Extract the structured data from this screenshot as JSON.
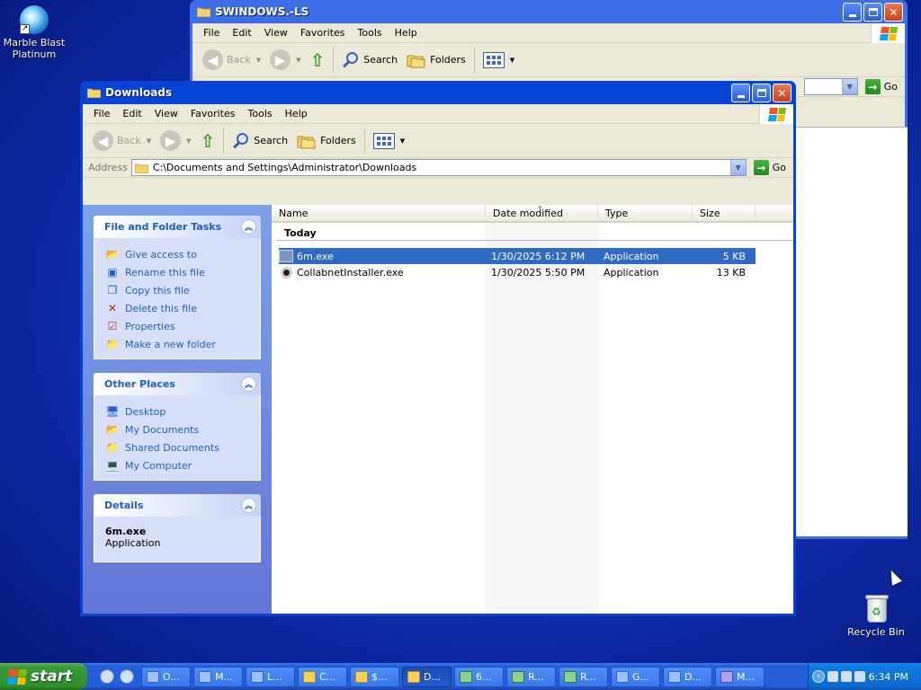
{
  "desktop": {
    "icons": [
      {
        "label": "Marble Blast Platinum",
        "icon": "marble-blast-icon"
      },
      {
        "label": "Recycle Bin",
        "icon": "recycle-bin-icon"
      }
    ]
  },
  "back_window": {
    "title": "SWINDOWS.-LS",
    "menu": [
      "File",
      "Edit",
      "View",
      "Favorites",
      "Tools",
      "Help"
    ],
    "toolbar": {
      "back": "Back",
      "search": "Search",
      "folders": "Folders"
    },
    "go": "Go"
  },
  "front_window": {
    "title": "Downloads",
    "menu": [
      "File",
      "Edit",
      "View",
      "Favorites",
      "Tools",
      "Help"
    ],
    "toolbar": {
      "back": "Back",
      "search": "Search",
      "folders": "Folders"
    },
    "address": {
      "label": "Address",
      "value": "C:\\Documents and Settings\\Administrator\\Downloads",
      "go": "Go"
    },
    "file_tasks": {
      "title": "File and Folder Tasks",
      "items": [
        "Give access to",
        "Rename this file",
        "Copy this file",
        "Delete this file",
        "Properties",
        "Make a new folder"
      ]
    },
    "other_places": {
      "title": "Other Places",
      "items": [
        "Desktop",
        "My Documents",
        "Shared Documents",
        "My Computer"
      ]
    },
    "details": {
      "title": "Details",
      "name": "6m.exe",
      "type": "Application"
    },
    "columns": [
      "Name",
      "Date modified",
      "Type",
      "Size"
    ],
    "group": "Today",
    "files": [
      {
        "name": "6m.exe",
        "date": "1/30/2025 6:12 PM",
        "type": "Application",
        "size": "5 KB",
        "selected": true
      },
      {
        "name": "CollabnetInstaller.exe",
        "date": "1/30/2025 5:50 PM",
        "type": "Application",
        "size": "13 KB",
        "selected": false
      }
    ]
  },
  "taskbar": {
    "start_label": "start",
    "buttons": [
      "O...",
      "M...",
      "L...",
      "C...",
      "$...",
      "D...",
      "6...",
      "R...",
      "R...",
      "G...",
      "D...",
      "M..."
    ],
    "clock": "6:34 PM"
  },
  "colors": {
    "xp_blue": "#0843d8",
    "selection": "#316ac5",
    "start_green": "#379937"
  }
}
